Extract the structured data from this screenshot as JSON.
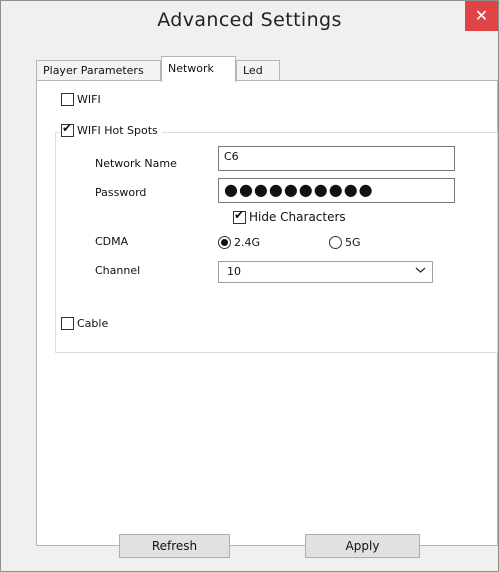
{
  "window": {
    "title": "Advanced Settings",
    "close_glyph": "✕"
  },
  "tabs": [
    {
      "label": "Player Parameters"
    },
    {
      "label": "Network"
    },
    {
      "label": "Led"
    }
  ],
  "wifi": {
    "label": "WIFI",
    "checked": false
  },
  "hotspot": {
    "label": "WIFI Hot Spots",
    "checked": true,
    "network_name_label": "Network Name",
    "network_name_value": "C6",
    "password_label": "Password",
    "password_value": "●●●●●●●●●●",
    "hide_characters_label": "Hide Characters",
    "hide_characters_checked": true,
    "cdma_label": "CDMA",
    "cdma_options": [
      {
        "label": "2.4G",
        "selected": true
      },
      {
        "label": "5G",
        "selected": false
      }
    ],
    "channel_label": "Channel",
    "channel_value": "10"
  },
  "cable": {
    "label": "Cable",
    "checked": false
  },
  "buttons": {
    "refresh": "Refresh",
    "apply": "Apply"
  }
}
